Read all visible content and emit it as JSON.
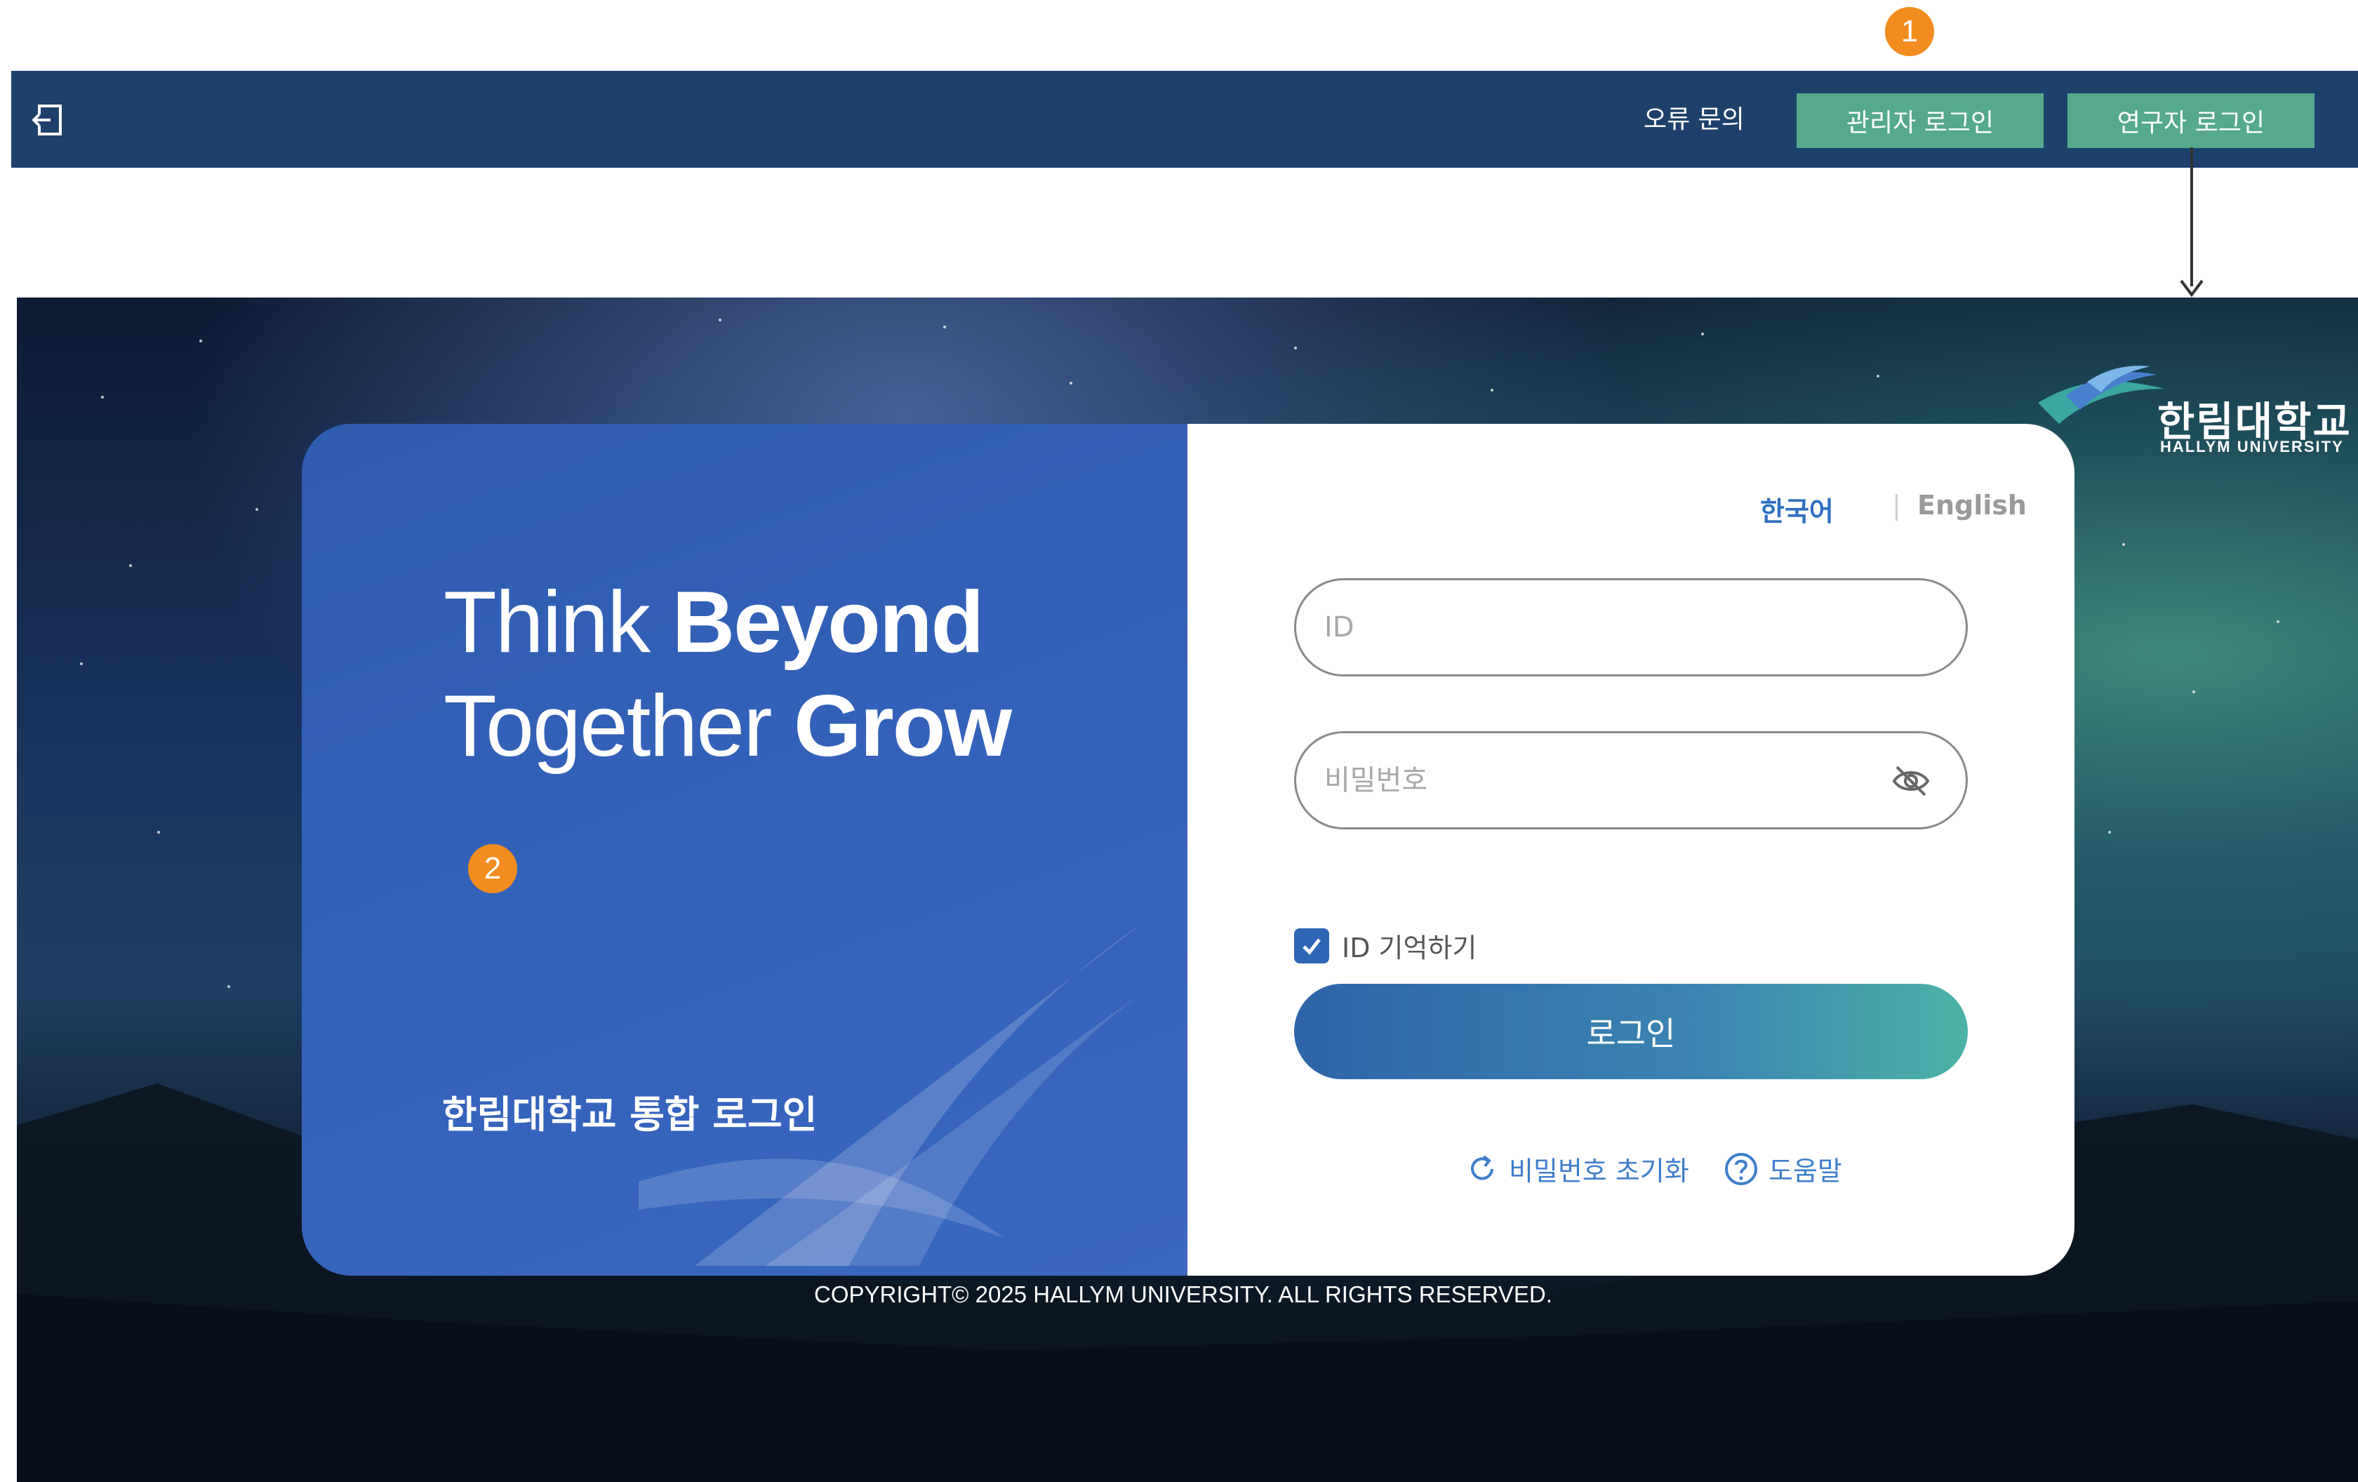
{
  "markers": {
    "one": "1",
    "two": "2"
  },
  "topbar": {
    "logout_icon": "logout-icon",
    "error_inquiry": "오류 문의",
    "admin_login": "관리자 로그인",
    "researcher_login": "연구자 로그인"
  },
  "logo": {
    "korean": "한림대학교",
    "english": "HALLYM UNIVERSITY"
  },
  "hero": {
    "line1_light": "Think ",
    "line1_bold": "Beyond",
    "line2_light": "Together ",
    "line2_bold": "Grow",
    "title": "한림대학교 통합 로그인"
  },
  "language": {
    "korean": "한국어",
    "separator": "|",
    "english": "English",
    "selected": "한국어"
  },
  "form": {
    "id_placeholder": "ID",
    "id_value": "",
    "password_placeholder": "비밀번호",
    "password_value": "",
    "eye_icon": "eye-slash-icon",
    "remember_label": "ID 기억하기",
    "remember_checked": true,
    "login_button": "로그인",
    "reset_password": "비밀번호 초기화",
    "help": "도움말"
  },
  "footer": {
    "copyright": "COPYRIGHT© 2025 HALLYM UNIVERSITY. ALL RIGHTS RESERVED."
  },
  "colors": {
    "nav_bg": "#1d416b",
    "nav_button": "#56a98c",
    "card_left": "#3462bb",
    "accent_blue": "#2f6fc0",
    "marker": "#f28c1e"
  }
}
